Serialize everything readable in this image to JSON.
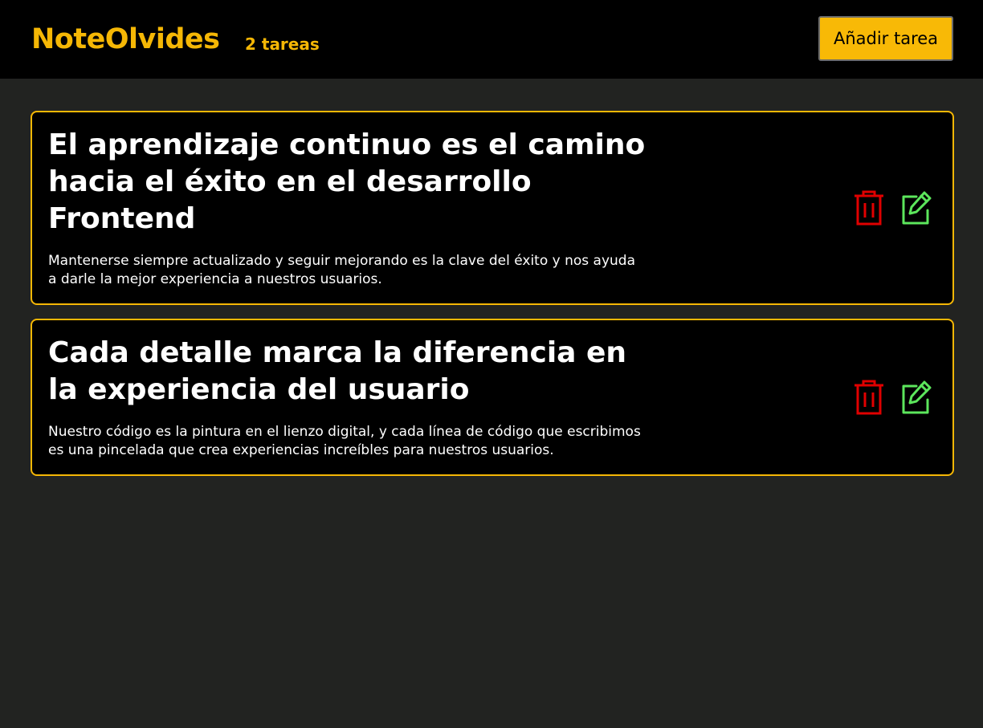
{
  "header": {
    "brand": "NoteOlvides",
    "task_count": "2 tareas",
    "add_button_label": "Añadir tarea"
  },
  "tasks": [
    {
      "title": "El aprendizaje continuo es el camino hacia el éxito en el desarrollo Frontend",
      "description": "Mantenerse siempre actualizado y seguir mejorando es la clave del éxito y nos ayuda a darle la mejor experiencia a nuestros usuarios.",
      "delete_icon": "trash-icon",
      "edit_icon": "edit-icon"
    },
    {
      "title": "Cada detalle marca la diferencia en la experiencia del usuario",
      "description": "Nuestro código es la pintura en el lienzo digital, y cada línea de código que escribimos es una pincelada que crea experiencias increíbles para nuestros usuarios.",
      "delete_icon": "trash-icon",
      "edit_icon": "edit-icon"
    }
  ],
  "colors": {
    "accent": "#f5b705",
    "background": "#222321",
    "card": "#000000",
    "delete": "#e00000",
    "edit": "#5ce65c"
  }
}
